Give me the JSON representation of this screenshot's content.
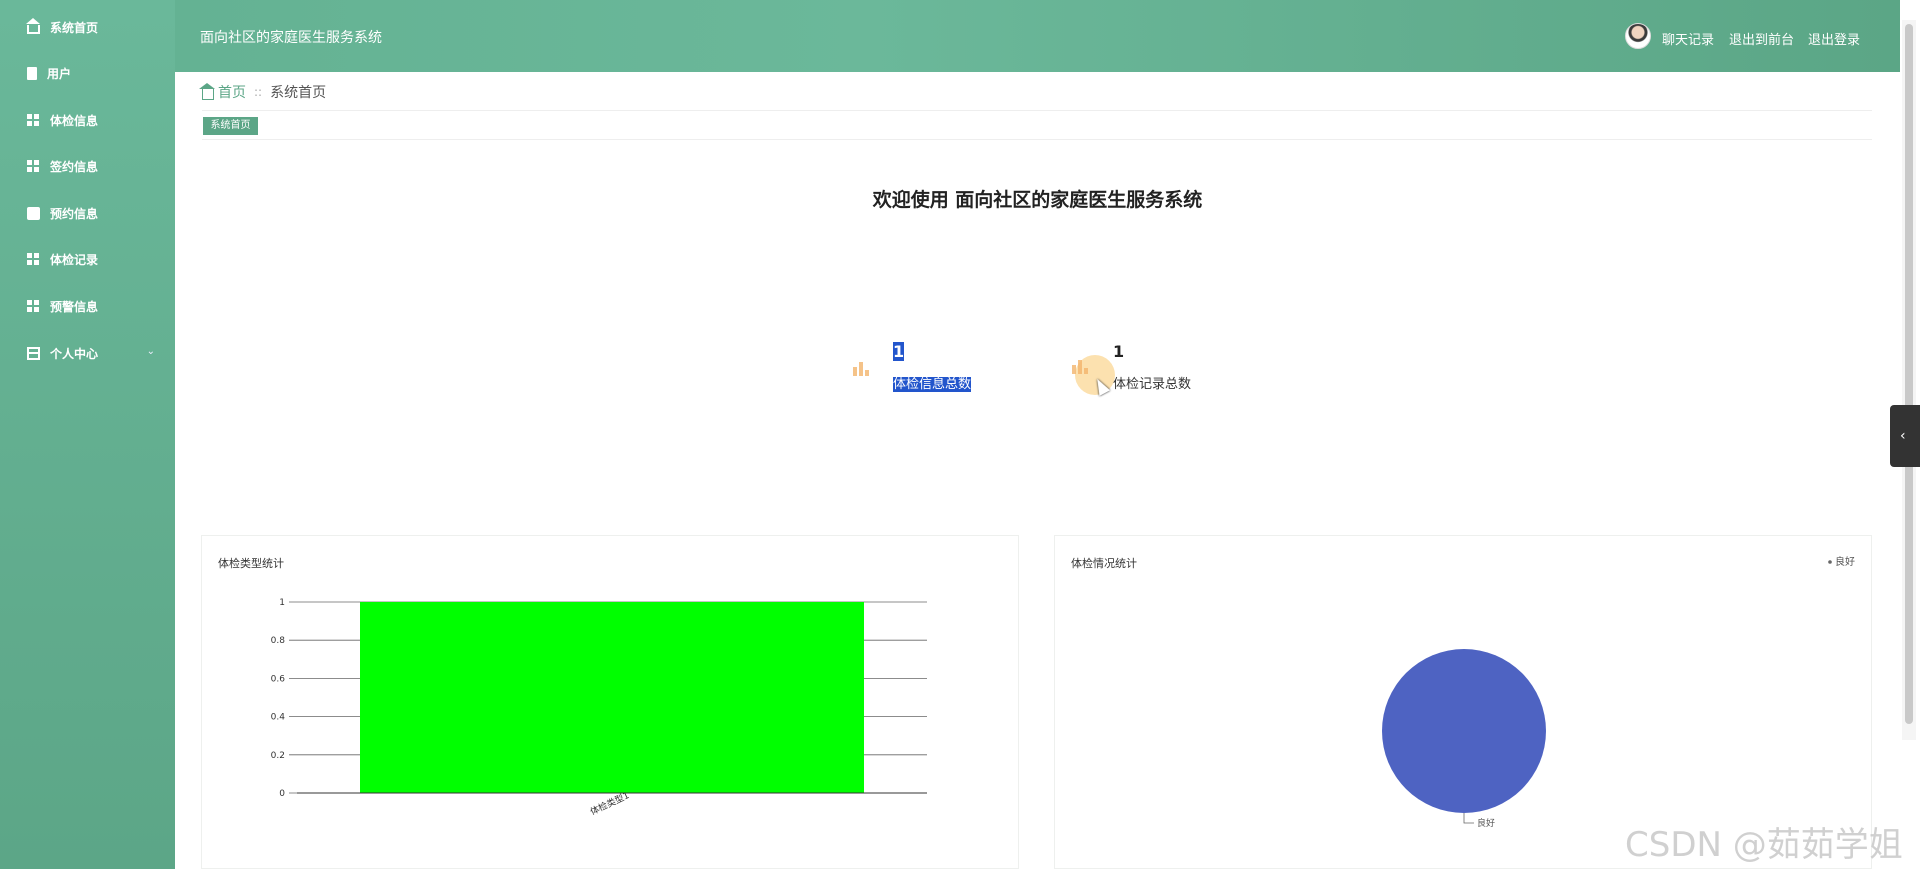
{
  "sidebar": {
    "items": [
      {
        "label": "系统首页",
        "icon": "home-icon"
      },
      {
        "label": "用户",
        "icon": "user-doc-icon"
      },
      {
        "label": "体检信息",
        "icon": "grid-icon"
      },
      {
        "label": "签约信息",
        "icon": "grid-icon"
      },
      {
        "label": "预约信息",
        "icon": "box-icon"
      },
      {
        "label": "体检记录",
        "icon": "grid-icon"
      },
      {
        "label": "预警信息",
        "icon": "grid-icon"
      },
      {
        "label": "个人中心",
        "icon": "frame-icon"
      }
    ]
  },
  "header": {
    "title": "面向社区的家庭医生服务系统",
    "links": [
      "聊天记录",
      "退出到前台",
      "退出登录"
    ]
  },
  "breadcrumb": {
    "home": "首页",
    "separator": "::",
    "current": "系统首页"
  },
  "tabs": [
    "系统首页"
  ],
  "welcome": "欢迎使用 面向社区的家庭医生服务系统",
  "stats": [
    {
      "value": "1",
      "label": "体检信息总数",
      "selected": true
    },
    {
      "value": "1",
      "label": "体检记录总数",
      "selected": false
    }
  ],
  "colors": {
    "accent": "#5ca687",
    "bar": "#00ff00",
    "pie": "#4e63c2",
    "selection": "#2255cc"
  },
  "chart_data": [
    {
      "type": "bar",
      "title": "体检类型统计",
      "categories": [
        "体检类型1"
      ],
      "values": [
        1
      ],
      "ylim": [
        0,
        1
      ],
      "yticks": [
        "0",
        "0.2",
        "0.4",
        "0.6",
        "0.8",
        "1"
      ],
      "grid": true
    },
    {
      "type": "pie",
      "title": "体检情况统计",
      "labels": [
        "良好"
      ],
      "values": [
        1
      ],
      "legend": "top-right"
    }
  ],
  "watermark": "CSDN @茹茹学姐"
}
